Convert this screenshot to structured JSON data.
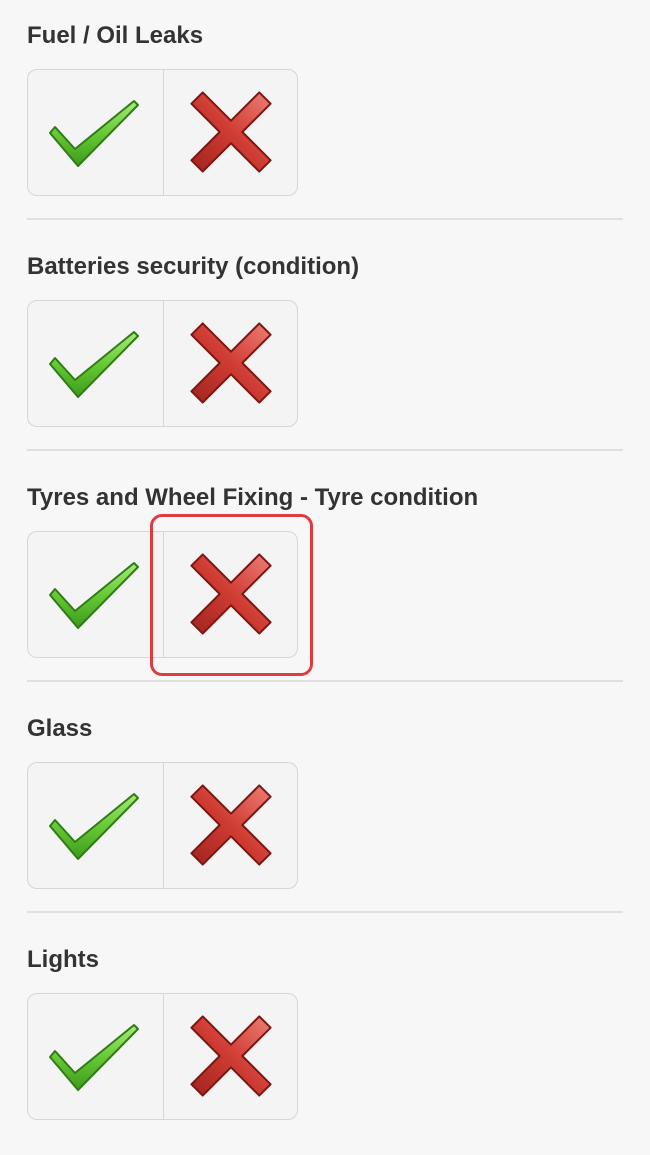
{
  "checklist": {
    "items": [
      {
        "title": "Fuel / Oil Leaks"
      },
      {
        "title": "Batteries security (condition)"
      },
      {
        "title": "Tyres and Wheel Fixing - Tyre condition",
        "highlighted": "fail"
      },
      {
        "title": "Glass"
      },
      {
        "title": "Lights"
      }
    ]
  },
  "icons": {
    "pass": "check-mark-icon",
    "fail": "cross-mark-icon"
  },
  "colors": {
    "check": "#5cbf2a",
    "cross": "#c0302a",
    "highlight": "#e03c40"
  }
}
